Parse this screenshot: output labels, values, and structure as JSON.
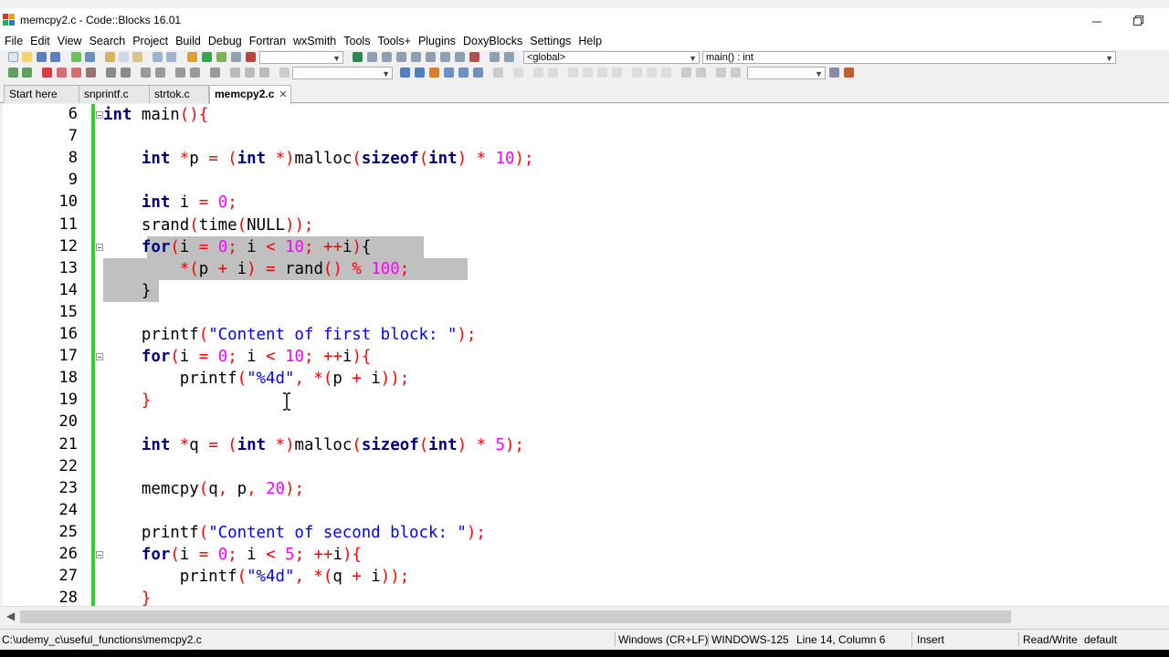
{
  "window": {
    "title": "memcpy2.c - Code::Blocks 16.01"
  },
  "menu": [
    "File",
    "Edit",
    "View",
    "Search",
    "Project",
    "Build",
    "Debug",
    "Fortran",
    "wxSmith",
    "Tools",
    "Tools+",
    "Plugins",
    "DoxyBlocks",
    "Settings",
    "Help"
  ],
  "toolbar": {
    "scope_combo": "<global>",
    "function_combo": "main() : int",
    "build_target_combo": "",
    "search_combo": ""
  },
  "tabs": [
    {
      "label": "Start here",
      "active": false
    },
    {
      "label": "snprintf.c",
      "active": false
    },
    {
      "label": "strtok.c",
      "active": false
    },
    {
      "label": "memcpy2.c",
      "active": true
    }
  ],
  "editor": {
    "lines": [
      {
        "n": "6",
        "tokens": [
          [
            "kw",
            "int"
          ],
          [
            "pl",
            " main"
          ],
          [
            "op",
            "(){"
          ]
        ]
      },
      {
        "n": "7",
        "tokens": []
      },
      {
        "n": "8",
        "tokens": [
          [
            "pl",
            "    "
          ],
          [
            "kw",
            "int"
          ],
          [
            "pl",
            " "
          ],
          [
            "op",
            "*"
          ],
          [
            "pl",
            "p "
          ],
          [
            "op",
            "="
          ],
          [
            "pl",
            " "
          ],
          [
            "op",
            "("
          ],
          [
            "kw",
            "int"
          ],
          [
            "pl",
            " "
          ],
          [
            "op",
            "*)"
          ],
          [
            "pl",
            "malloc"
          ],
          [
            "op",
            "("
          ],
          [
            "kw",
            "sizeof"
          ],
          [
            "op",
            "("
          ],
          [
            "kw",
            "int"
          ],
          [
            "op",
            ")"
          ],
          [
            "pl",
            " "
          ],
          [
            "op",
            "*"
          ],
          [
            "pl",
            " "
          ],
          [
            "num",
            "10"
          ],
          [
            "op",
            ");"
          ]
        ]
      },
      {
        "n": "9",
        "tokens": []
      },
      {
        "n": "10",
        "tokens": [
          [
            "pl",
            "    "
          ],
          [
            "kw",
            "int"
          ],
          [
            "pl",
            " i "
          ],
          [
            "op",
            "="
          ],
          [
            "pl",
            " "
          ],
          [
            "num",
            "0"
          ],
          [
            "op",
            ";"
          ]
        ]
      },
      {
        "n": "11",
        "tokens": [
          [
            "pl",
            "    srand"
          ],
          [
            "op",
            "("
          ],
          [
            "pl",
            "time"
          ],
          [
            "op",
            "("
          ],
          [
            "pl",
            "NULL"
          ],
          [
            "op",
            "));"
          ]
        ]
      },
      {
        "n": "12",
        "tokens": [
          [
            "pl",
            "    "
          ],
          [
            "kw",
            "for"
          ],
          [
            "op",
            "("
          ],
          [
            "pl",
            "i "
          ],
          [
            "op",
            "="
          ],
          [
            "pl",
            " "
          ],
          [
            "num",
            "0"
          ],
          [
            "op",
            ";"
          ],
          [
            "pl",
            " i "
          ],
          [
            "op",
            "<"
          ],
          [
            "pl",
            " "
          ],
          [
            "num",
            "10"
          ],
          [
            "op",
            ";"
          ],
          [
            "pl",
            " "
          ],
          [
            "op",
            "++"
          ],
          [
            "pl",
            "i"
          ],
          [
            "op",
            ")"
          ],
          [
            "pl",
            "{"
          ]
        ]
      },
      {
        "n": "13",
        "tokens": [
          [
            "pl",
            "        "
          ],
          [
            "op",
            "*("
          ],
          [
            "pl",
            "p "
          ],
          [
            "op",
            "+"
          ],
          [
            "pl",
            " i"
          ],
          [
            "op",
            ")"
          ],
          [
            "pl",
            " "
          ],
          [
            "op",
            "="
          ],
          [
            "pl",
            " rand"
          ],
          [
            "op",
            "()"
          ],
          [
            "pl",
            " "
          ],
          [
            "op",
            "%"
          ],
          [
            "pl",
            " "
          ],
          [
            "num",
            "100"
          ],
          [
            "op",
            ";"
          ]
        ]
      },
      {
        "n": "14",
        "tokens": [
          [
            "pl",
            "    }"
          ]
        ]
      },
      {
        "n": "15",
        "tokens": []
      },
      {
        "n": "16",
        "tokens": [
          [
            "pl",
            "    printf"
          ],
          [
            "op",
            "("
          ],
          [
            "str",
            "\"Content of first block: \""
          ],
          [
            "op",
            ");"
          ]
        ]
      },
      {
        "n": "17",
        "tokens": [
          [
            "pl",
            "    "
          ],
          [
            "kw",
            "for"
          ],
          [
            "op",
            "("
          ],
          [
            "pl",
            "i "
          ],
          [
            "op",
            "="
          ],
          [
            "pl",
            " "
          ],
          [
            "num",
            "0"
          ],
          [
            "op",
            ";"
          ],
          [
            "pl",
            " i "
          ],
          [
            "op",
            "<"
          ],
          [
            "pl",
            " "
          ],
          [
            "num",
            "10"
          ],
          [
            "op",
            ";"
          ],
          [
            "pl",
            " "
          ],
          [
            "op",
            "++"
          ],
          [
            "pl",
            "i"
          ],
          [
            "op",
            "){"
          ]
        ]
      },
      {
        "n": "18",
        "tokens": [
          [
            "pl",
            "        printf"
          ],
          [
            "op",
            "("
          ],
          [
            "str",
            "\"%4d\""
          ],
          [
            "op",
            ","
          ],
          [
            "pl",
            " "
          ],
          [
            "op",
            "*("
          ],
          [
            "pl",
            "p "
          ],
          [
            "op",
            "+"
          ],
          [
            "pl",
            " i"
          ],
          [
            "op",
            "));"
          ]
        ]
      },
      {
        "n": "19",
        "tokens": [
          [
            "pl",
            "    "
          ],
          [
            "op",
            "}"
          ]
        ]
      },
      {
        "n": "20",
        "tokens": []
      },
      {
        "n": "21",
        "tokens": [
          [
            "pl",
            "    "
          ],
          [
            "kw",
            "int"
          ],
          [
            "pl",
            " "
          ],
          [
            "op",
            "*"
          ],
          [
            "pl",
            "q "
          ],
          [
            "op",
            "="
          ],
          [
            "pl",
            " "
          ],
          [
            "op",
            "("
          ],
          [
            "kw",
            "int"
          ],
          [
            "pl",
            " "
          ],
          [
            "op",
            "*)"
          ],
          [
            "pl",
            "malloc"
          ],
          [
            "op",
            "("
          ],
          [
            "kw",
            "sizeof"
          ],
          [
            "op",
            "("
          ],
          [
            "kw",
            "int"
          ],
          [
            "op",
            ")"
          ],
          [
            "pl",
            " "
          ],
          [
            "op",
            "*"
          ],
          [
            "pl",
            " "
          ],
          [
            "num",
            "5"
          ],
          [
            "op",
            ");"
          ]
        ]
      },
      {
        "n": "22",
        "tokens": []
      },
      {
        "n": "23",
        "tokens": [
          [
            "pl",
            "    memcpy"
          ],
          [
            "op",
            "("
          ],
          [
            "pl",
            "q"
          ],
          [
            "op",
            ","
          ],
          [
            "pl",
            " p"
          ],
          [
            "op",
            ","
          ],
          [
            "pl",
            " "
          ],
          [
            "num",
            "20"
          ],
          [
            "op",
            ");"
          ]
        ]
      },
      {
        "n": "24",
        "tokens": []
      },
      {
        "n": "25",
        "tokens": [
          [
            "pl",
            "    printf"
          ],
          [
            "op",
            "("
          ],
          [
            "str",
            "\"Content of second block: \""
          ],
          [
            "op",
            ");"
          ]
        ]
      },
      {
        "n": "26",
        "tokens": [
          [
            "pl",
            "    "
          ],
          [
            "kw",
            "for"
          ],
          [
            "op",
            "("
          ],
          [
            "pl",
            "i "
          ],
          [
            "op",
            "="
          ],
          [
            "pl",
            " "
          ],
          [
            "num",
            "0"
          ],
          [
            "op",
            ";"
          ],
          [
            "pl",
            " i "
          ],
          [
            "op",
            "<"
          ],
          [
            "pl",
            " "
          ],
          [
            "num",
            "5"
          ],
          [
            "op",
            ";"
          ],
          [
            "pl",
            " "
          ],
          [
            "op",
            "++"
          ],
          [
            "pl",
            "i"
          ],
          [
            "op",
            "){"
          ]
        ]
      },
      {
        "n": "27",
        "tokens": [
          [
            "pl",
            "        printf"
          ],
          [
            "op",
            "("
          ],
          [
            "str",
            "\"%4d\""
          ],
          [
            "op",
            ","
          ],
          [
            "pl",
            " "
          ],
          [
            "op",
            "*("
          ],
          [
            "pl",
            "q "
          ],
          [
            "op",
            "+"
          ],
          [
            "pl",
            " i"
          ],
          [
            "op",
            "));"
          ]
        ]
      },
      {
        "n": "28",
        "tokens": [
          [
            "pl",
            "    "
          ],
          [
            "op",
            "}"
          ]
        ]
      }
    ]
  },
  "statusbar": {
    "path": "C:\\udemy_c\\useful_functions\\memcpy2.c",
    "line_endings": "Windows (CR+LF)",
    "encoding": "WINDOWS-125",
    "position": "Line 14, Column 6",
    "mode": "Insert",
    "access": "Read/Write",
    "theme": "default"
  },
  "colors": {
    "keyword": "#00007f",
    "operator": "#ff0000",
    "number": "#ff00ff",
    "string": "#0000ff",
    "selection": "#c0c0c0",
    "change_bar": "#2fd12f"
  }
}
